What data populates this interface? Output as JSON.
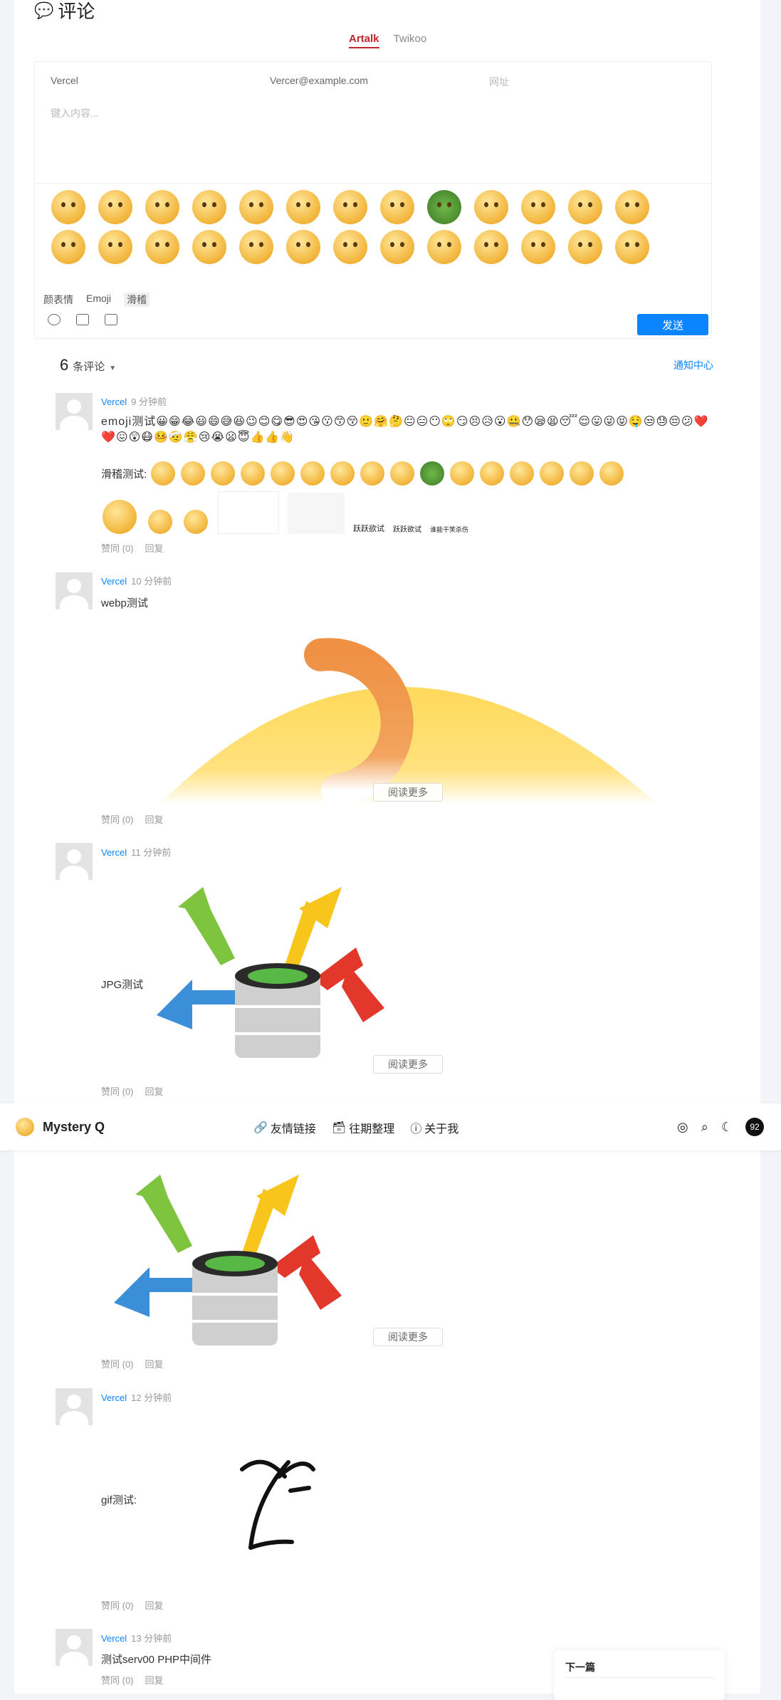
{
  "comment_section": {
    "title": "评论",
    "tabs": [
      {
        "label": "Artalk",
        "active": true
      },
      {
        "label": "Twikoo",
        "active": false
      }
    ]
  },
  "editor": {
    "name_value": "Vercel",
    "email_value": "Vercer@example.com",
    "url_placeholder": "网址",
    "content_placeholder": "键入内容...",
    "emoticon_tabs": [
      "颜表情",
      "Emoji",
      "滑稽"
    ],
    "selected_emoticon_tab": "滑稽",
    "send_label": "发送"
  },
  "comments_header": {
    "count": "6",
    "count_label": "条评论",
    "notify_label": "通知中心"
  },
  "comments": [
    {
      "author": "Vercel",
      "time": "9 分钟前",
      "text": "emoji测试😀😁😂😃😄😅😆😉😊😋😎😍😘😗😙😚🙂🤗🤔😐😑😶🙄😏😣😥😮🤐😯😪😫😴😌😛😜😝🤤😒😓😔😕❤️❤️😖😲😷🤒🤕😤😢😭😦😇👍👍👋",
      "text2": "滑稽测试:",
      "sticker_captions": [
        "跃跃欲试",
        "跃跃欲试",
        "谁能干笑杀伤"
      ],
      "like_label": "赞同 (0)",
      "reply_label": "回复"
    },
    {
      "author": "Vercel",
      "time": "10 分钟前",
      "text": "webp测试",
      "read_more": "阅读更多",
      "like_label": "赞同 (0)",
      "reply_label": "回复"
    },
    {
      "author": "Vercel",
      "time": "11 分钟前",
      "text": "JPG测试",
      "read_more": "阅读更多",
      "like_label": "赞同 (0)",
      "reply_label": "回复"
    },
    {
      "read_more": "阅读更多",
      "like_label": "赞同 (0)",
      "reply_label": "回复"
    },
    {
      "author": "Vercel",
      "time": "12 分钟前",
      "text": "gif测试:",
      "like_label": "赞同 (0)",
      "reply_label": "回复"
    },
    {
      "author": "Vercel",
      "time": "13 分钟前",
      "text": "测试serv00 PHP中间件",
      "like_label": "赞同 (0)",
      "reply_label": "回复"
    }
  ],
  "navbar": {
    "site_name": "Mystery Q",
    "links": [
      {
        "label": "友情链接",
        "icon": "link-icon"
      },
      {
        "label": "往期整理",
        "icon": "archive-icon"
      },
      {
        "label": "关于我",
        "icon": "info-icon"
      }
    ],
    "badge": "92"
  },
  "next_post": {
    "label": "下一篇"
  }
}
